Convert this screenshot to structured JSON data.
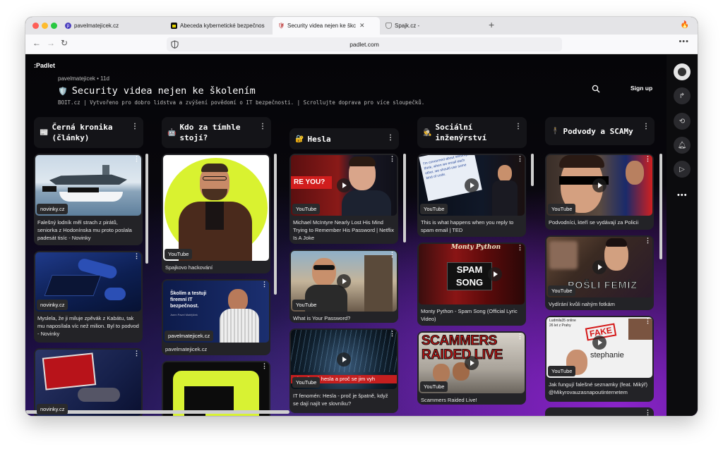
{
  "browser": {
    "tabs": [
      {
        "label": "pavelmatejicek.cz"
      },
      {
        "label": "Abeceda kybernetické bezpečnos"
      },
      {
        "label": "Security videa nejen ke škc"
      },
      {
        "label": "Spajk.cz -"
      }
    ],
    "url": "padlet.com"
  },
  "app": {
    "logo": ":Padlet",
    "author": "pavelmatejicek • 11d",
    "title": "Security videa nejen ke školením",
    "subtitle": "BOIT.cz | Vytvořeno pro dobro lidstva a zvýšení povědomí o IT bezpečnosti. | Scrollujte doprava pro více sloupečků.",
    "signup": "Sign up"
  },
  "columns": [
    {
      "emoji": "📰",
      "title": "Černá kronika (články)",
      "cards": [
        {
          "source": "novinky.cz",
          "text": "Falešný lodník měl strach z pirátů, seniorka z Hodonínska mu proto poslala padesát tisíc - Novinky"
        },
        {
          "source": "novinky.cz",
          "text": "Myslela, že ji miluje zpěvák z Kabátu, tak mu naposílala víc než milion. Byl to podvod - Novinky"
        },
        {
          "source": "novinky.cz",
          "text": ""
        }
      ]
    },
    {
      "emoji": "🤖",
      "title": "Kdo za tímhle stojí?",
      "cards": [
        {
          "source": "YouTube",
          "text": "Spajkovo hackování"
        },
        {
          "source": "pavelmatejicek.cz",
          "text": "pavelmatejicek.cz",
          "overlay": "Školím a testuji firemní IT bezpečnost.",
          "overlay_small": "Jsem Pavel Matějíček"
        },
        {
          "source": "",
          "text": ""
        }
      ]
    },
    {
      "emoji": "🔐",
      "title": "Hesla",
      "cards": [
        {
          "source": "YouTube",
          "text": "Michael McIntyre Nearly Lost His Mind Trying to Remember His Password | Netflix Is A Joke",
          "overlay": "RE YOU?"
        },
        {
          "source": "YouTube",
          "text": "What is Your Password?"
        },
        {
          "source": "YouTube",
          "text": "IT fenomén: Hesla - proč je špatně, když se dají najít ve slovníku?",
          "overlay": "Slovníková hesla a proč se jim vyh"
        }
      ]
    },
    {
      "emoji": "🕵",
      "title": "Sociální inženýrství",
      "cards": [
        {
          "source": "YouTube",
          "text": "This is what happens when you reply to spam email | TED",
          "overlay": "I'm concerned about security, think, when we email each other, we should use some kind of code."
        },
        {
          "source": "",
          "text": "Monty Python - Spam Song (Official Lyric Video)",
          "overlay": "SPAM SONG",
          "overlay_top": "Monty Python"
        },
        {
          "source": "YouTube",
          "text": "Scammers Raided Live!",
          "overlay": "SCAMMERS RAIDED LIVE"
        }
      ]
    },
    {
      "emoji": "🕴",
      "title": "Podvody a SCAMy",
      "cards": [
        {
          "source": "YouTube",
          "text": "Podvodníci, kteří se vydávají za Policii"
        },
        {
          "source": "YouTube",
          "text": "Vydírání kvůli nahým fotkám",
          "overlay": "POŠLI FEMÍZ"
        },
        {
          "source": "YouTube",
          "text": "Jak fungují falešné seznamky (feat. Mikýř) @Mikyrovauzasnapoutinternetem",
          "overlay": "FAKE",
          "overlay_name": "stephanie",
          "overlay_top": "Ludmila35 online 26 let z Prahy"
        }
      ]
    }
  ],
  "colors": {
    "accent_purple": "#8b24c9",
    "card_bg": "#232327",
    "header_bg": "#141418"
  }
}
